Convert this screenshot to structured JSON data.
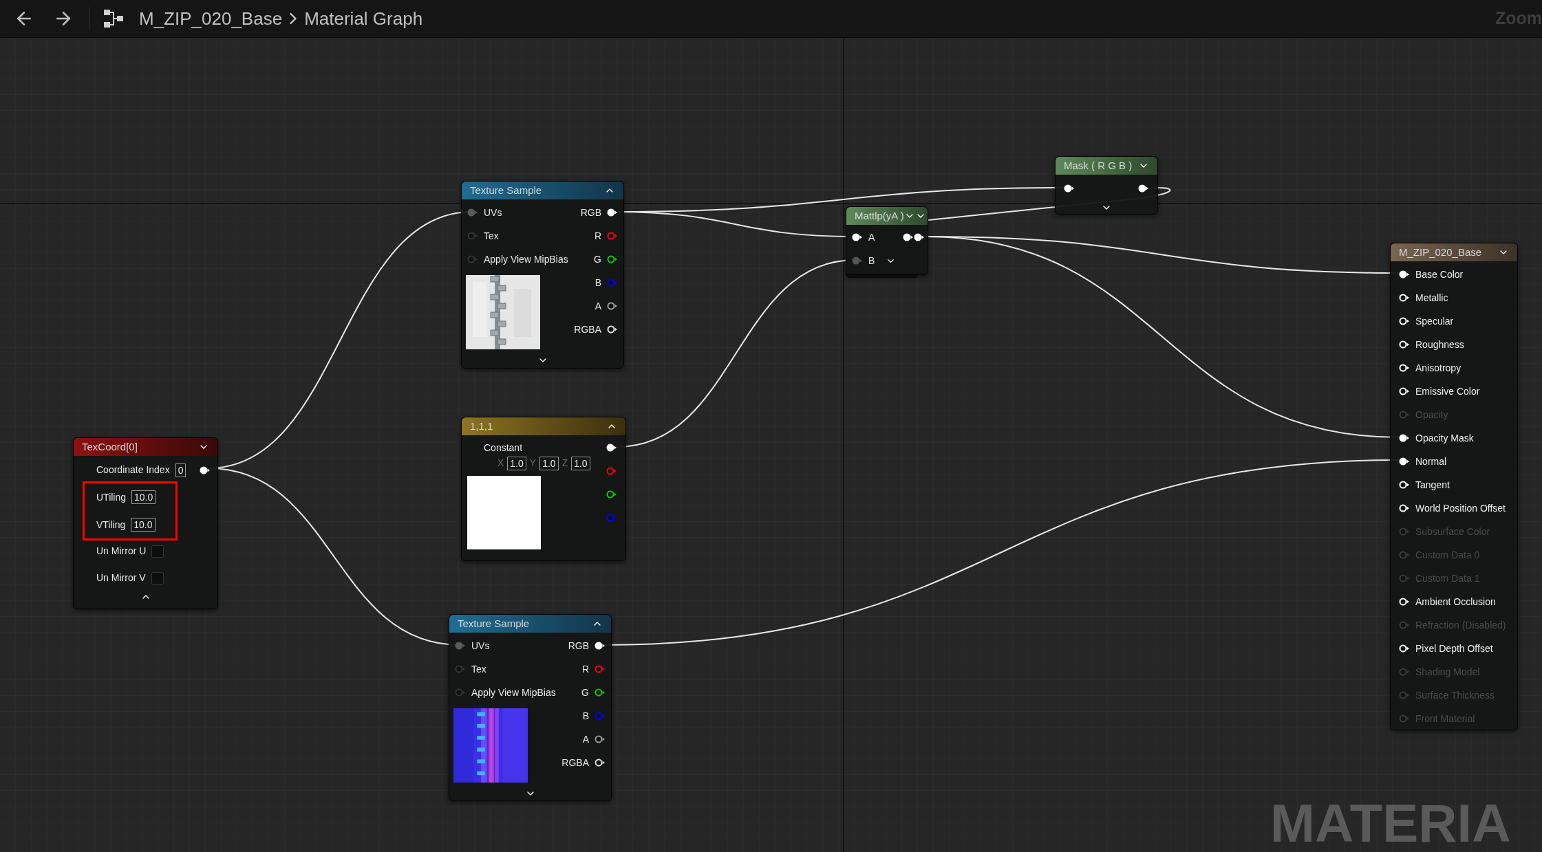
{
  "toolbar": {
    "breadcrumb": [
      "M_ZIP_020_Base",
      "Material Graph"
    ],
    "zoom_label": "Zoom"
  },
  "nodes": [
    {
      "kind": "mask",
      "title": "Mask ( R G B )",
      "inputs": [
        {
          "connected": true
        }
      ],
      "outputs": [
        {
          "connected": true
        }
      ]
    },
    {
      "kind": "texture",
      "title": "Texture Sample",
      "inputs": [
        {
          "label": "UVs",
          "connected": true
        },
        {
          "label": "Tex",
          "connected": false
        },
        {
          "label": "Apply View MipBias",
          "connected": false
        }
      ],
      "outputs": [
        {
          "label": "RGB",
          "color": "#ffffff",
          "connected": true
        },
        {
          "label": "R",
          "color": "#ff0000",
          "connected": false
        },
        {
          "label": "G",
          "color": "#00d000",
          "connected": false
        },
        {
          "label": "B",
          "color": "#0000ff",
          "connected": false
        },
        {
          "label": "A",
          "color": "#9a9a9a",
          "connected": false
        },
        {
          "label": "RGBA",
          "color": "#e0e0e0",
          "connected": false
        }
      ]
    },
    {
      "kind": "math",
      "title": "Mattlp(yA )",
      "inputs": [
        {
          "label": "A",
          "connected": true
        },
        {
          "label": "B",
          "connected": true
        }
      ]
    },
    {
      "kind": "material",
      "title": "M_ZIP_020_Base",
      "inputs": [
        {
          "label": "Base Color",
          "connected": true,
          "disabled": false
        },
        {
          "label": "Metallic",
          "connected": false,
          "disabled": false
        },
        {
          "label": "Specular",
          "connected": false,
          "disabled": false
        },
        {
          "label": "Roughness",
          "connected": false,
          "disabled": false
        },
        {
          "label": "Anisotropy",
          "connected": false,
          "disabled": false
        },
        {
          "label": "Emissive Color",
          "connected": false,
          "disabled": false
        },
        {
          "label": "Opacity",
          "connected": false,
          "disabled": true
        },
        {
          "label": "Opacity Mask",
          "connected": true,
          "disabled": false
        },
        {
          "label": "Normal",
          "connected": true,
          "disabled": false
        },
        {
          "label": "Tangent",
          "connected": false,
          "disabled": false
        },
        {
          "label": "World Position Offset",
          "connected": false,
          "disabled": false
        },
        {
          "label": "Subsurface Color",
          "connected": false,
          "disabled": true
        },
        {
          "label": "Custom Data 0",
          "connected": false,
          "disabled": true
        },
        {
          "label": "Custom Data 1",
          "connected": false,
          "disabled": true
        },
        {
          "label": "Ambient Occlusion",
          "connected": false,
          "disabled": false
        },
        {
          "label": "Refraction (Disabled)",
          "connected": false,
          "disabled": true
        },
        {
          "label": "Pixel Depth Offset",
          "connected": false,
          "disabled": false
        },
        {
          "label": "Shading Model",
          "connected": false,
          "disabled": true
        },
        {
          "label": "Surface Thickness",
          "connected": false,
          "disabled": true
        },
        {
          "label": "Front Material",
          "connected": false,
          "disabled": true
        }
      ]
    },
    {
      "kind": "constant",
      "title": "1,1,1",
      "label": "Constant",
      "components": [
        {
          "axis": "X",
          "value": "1.0"
        },
        {
          "axis": "Y",
          "value": "1.0"
        },
        {
          "axis": "Z",
          "value": "1.0"
        }
      ],
      "outputs": [
        {
          "color": "#ffffff",
          "connected": true
        },
        {
          "color": "#ff0000",
          "connected": false
        },
        {
          "color": "#00d000",
          "connected": false
        },
        {
          "color": "#0000ff",
          "connected": false
        }
      ]
    },
    {
      "kind": "texcoord",
      "title": "TexCoord[0]",
      "fields": [
        {
          "label": "Coordinate Index",
          "value": "0",
          "highlighted": false
        },
        {
          "label": "UTiling",
          "value": "10.0",
          "highlighted": true
        },
        {
          "label": "VTiling",
          "value": "10.0",
          "highlighted": true
        }
      ],
      "checkboxes": [
        {
          "label": "Un Mirror U",
          "checked": false
        },
        {
          "label": "Un Mirror V",
          "checked": false
        }
      ],
      "outputs": [
        {
          "connected": true
        }
      ]
    },
    {
      "kind": "texture",
      "title": "Texture Sample",
      "inputs": [
        {
          "label": "UVs",
          "connected": true
        },
        {
          "label": "Tex",
          "connected": false
        },
        {
          "label": "Apply View MipBias",
          "connected": false
        }
      ],
      "outputs": [
        {
          "label": "RGB",
          "color": "#ffffff",
          "connected": true
        },
        {
          "label": "R",
          "color": "#ff0000",
          "connected": false
        },
        {
          "label": "G",
          "color": "#00d000",
          "connected": false
        },
        {
          "label": "B",
          "color": "#0000ff",
          "connected": false
        },
        {
          "label": "A",
          "color": "#9a9a9a",
          "connected": false
        },
        {
          "label": "RGBA",
          "color": "#e0e0e0",
          "connected": false
        }
      ]
    }
  ],
  "graph_type_label": "MATERIA"
}
